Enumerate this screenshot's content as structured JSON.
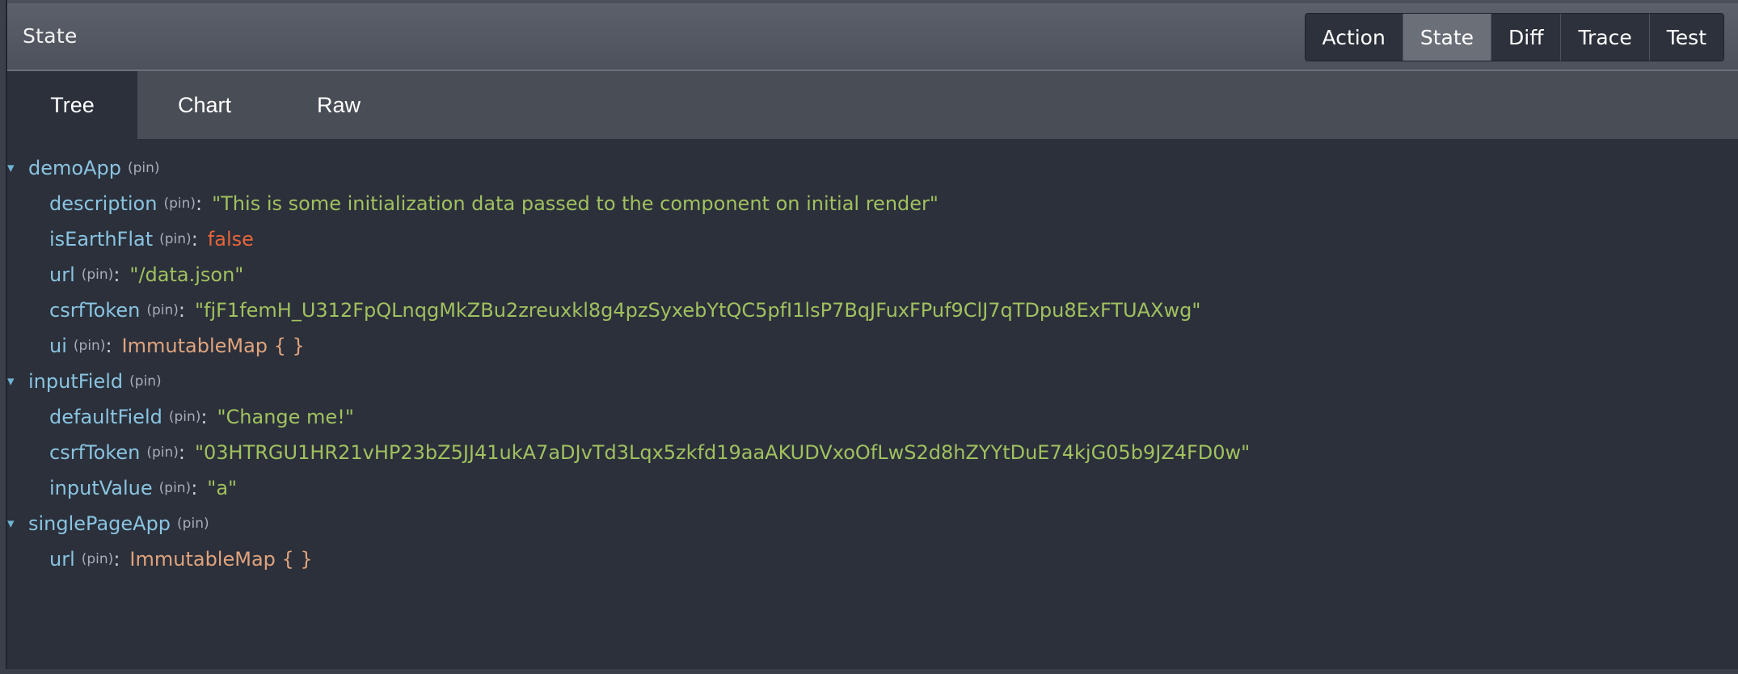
{
  "header": {
    "title": "State",
    "buttons": [
      {
        "label": "Action",
        "active": false
      },
      {
        "label": "State",
        "active": true
      },
      {
        "label": "Diff",
        "active": false
      },
      {
        "label": "Trace",
        "active": false
      },
      {
        "label": "Test",
        "active": false
      }
    ]
  },
  "tabs": [
    {
      "label": "Tree",
      "active": true
    },
    {
      "label": "Chart",
      "active": false
    },
    {
      "label": "Raw",
      "active": false
    }
  ],
  "tree": {
    "pin_label": "(pin)",
    "colon": ":",
    "expand_glyph": "▾",
    "demoApp": {
      "key": "demoApp",
      "description": {
        "key": "description",
        "value": "\"This is some initialization data passed to the component on initial render\""
      },
      "isEarthFlat": {
        "key": "isEarthFlat",
        "value": "false"
      },
      "url": {
        "key": "url",
        "value": "\"/data.json\""
      },
      "csrfToken": {
        "key": "csrfToken",
        "value": "\"fjF1femH_U312FpQLnqgMkZBu2zreuxkl8g4pzSyxebYtQC5pfI1lsP7BqJFuxFPuf9ClJ7qTDpu8ExFTUAXwg\""
      },
      "ui": {
        "key": "ui",
        "value": "ImmutableMap { }"
      }
    },
    "inputField": {
      "key": "inputField",
      "defaultField": {
        "key": "defaultField",
        "value": "\"Change me!\""
      },
      "csrfToken": {
        "key": "csrfToken",
        "value": "\"03HTRGU1HR21vHP23bZ5JJ41ukA7aDJvTd3Lqx5zkfd19aaAKUDVxoOfLwS2d8hZYYtDuE74kjG05b9JZ4FD0w\""
      },
      "inputValue": {
        "key": "inputValue",
        "value": "\"a\""
      }
    },
    "singlePageApp": {
      "key": "singlePageApp",
      "url": {
        "key": "url",
        "value": "ImmutableMap { }"
      }
    }
  },
  "colors": {
    "key": "#8ac4e0",
    "string": "#a1c15e",
    "boolean": "#e7653a",
    "map": "#e0a37c",
    "background": "#2b303b"
  }
}
